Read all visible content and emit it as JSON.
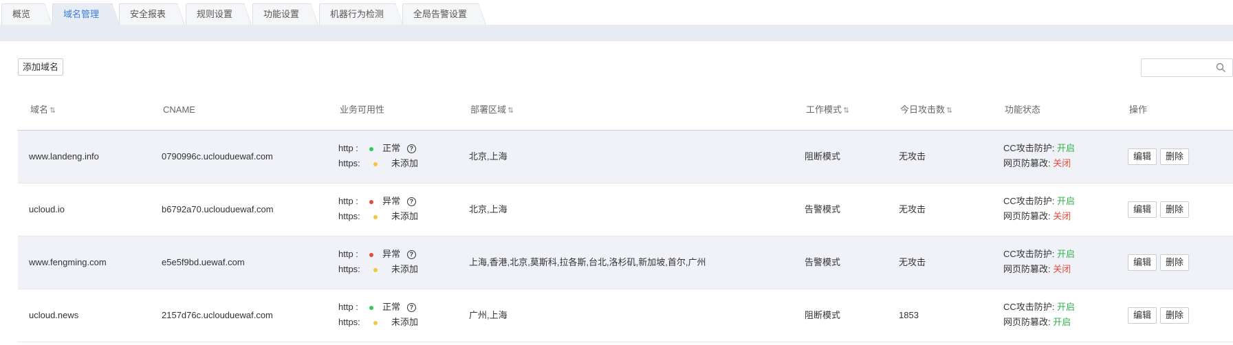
{
  "tabs": [
    {
      "label": "概览"
    },
    {
      "label": "域名管理"
    },
    {
      "label": "安全报表"
    },
    {
      "label": "规则设置"
    },
    {
      "label": "功能设置"
    },
    {
      "label": "机器行为检测"
    },
    {
      "label": "全局告警设置"
    }
  ],
  "toolbar": {
    "add_label": "添加域名",
    "search_placeholder": ""
  },
  "columns": {
    "domain": "域名",
    "cname": "CNAME",
    "availability": "业务可用性",
    "region": "部署区域",
    "mode": "工作模式",
    "attacks": "今日攻击数",
    "features": "功能状态",
    "ops": "操作",
    "sort_glyph": "⇅"
  },
  "labels": {
    "http": "http :",
    "https": "https:",
    "cc": "CC攻击防护:",
    "tamper": "网页防篡改:",
    "edit": "编辑",
    "delete": "删除"
  },
  "colors": {
    "green": "#34c759",
    "red": "#e64a3b",
    "yellow": "#f5c542",
    "accent": "#3a7be0"
  },
  "rows": [
    {
      "domain": "www.landeng.info",
      "cname": "0790996c.uclouduewaf.com",
      "http_status": "正常",
      "http_color": "green",
      "https_status": "未添加",
      "region": "北京,上海",
      "mode": "阻断模式",
      "attacks": "无攻击",
      "cc": "开启",
      "cc_state": "on",
      "tamper": "关闭",
      "tamper_state": "off"
    },
    {
      "domain": "ucloud.io",
      "cname": "b6792a70.uclouduewaf.com",
      "http_status": "异常",
      "http_color": "red",
      "https_status": "未添加",
      "region": "北京,上海",
      "mode": "告警模式",
      "attacks": "无攻击",
      "cc": "开启",
      "cc_state": "on",
      "tamper": "关闭",
      "tamper_state": "off"
    },
    {
      "domain": "www.fengming.com",
      "cname": "e5e5f9bd.uewaf.com",
      "http_status": "异常",
      "http_color": "red",
      "https_status": "未添加",
      "region": "上海,香港,北京,莫斯科,拉各斯,台北,洛杉矶,新加坡,首尔,广州",
      "mode": "告警模式",
      "attacks": "无攻击",
      "cc": "开启",
      "cc_state": "on",
      "tamper": "关闭",
      "tamper_state": "off"
    },
    {
      "domain": "ucloud.news",
      "cname": "2157d76c.uclouduewaf.com",
      "http_status": "正常",
      "http_color": "green",
      "https_status": "未添加",
      "region": "广州,上海",
      "mode": "阻断模式",
      "attacks": "1853",
      "cc": "开启",
      "cc_state": "on",
      "tamper": "开启",
      "tamper_state": "on"
    }
  ]
}
